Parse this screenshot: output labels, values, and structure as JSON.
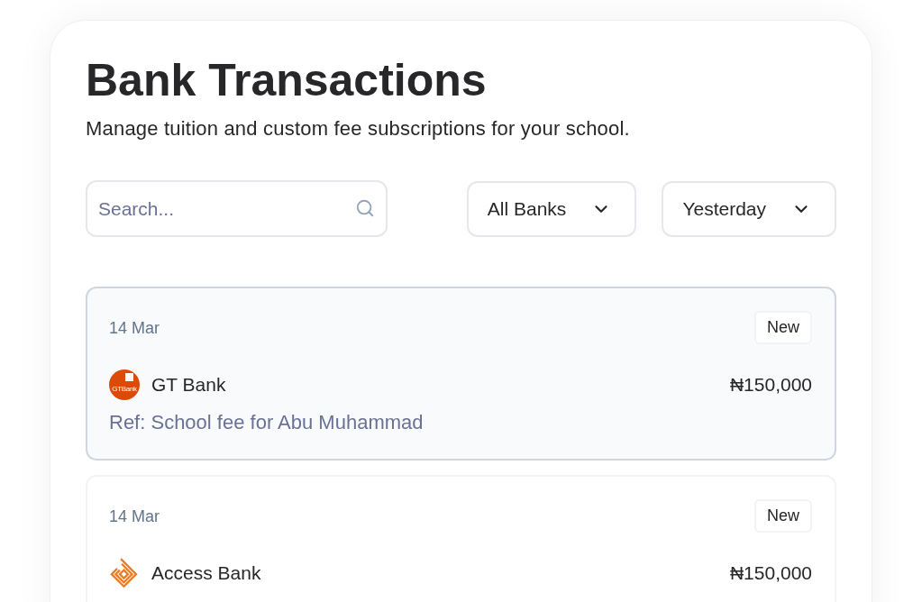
{
  "header": {
    "title": "Bank Transactions",
    "subtitle": "Manage tuition and custom fee subscriptions for your school."
  },
  "filters": {
    "search": {
      "placeholder": "Search..."
    },
    "dropdowns": [
      {
        "value": "All Banks"
      },
      {
        "value": "Yesterday"
      }
    ]
  },
  "transactions": [
    {
      "date": "14 Mar",
      "badge": "New",
      "bank": {
        "kind": "gtbank",
        "name": "GT Bank",
        "logo_text": "GTBank"
      },
      "amount": "₦150,000",
      "ref": "Ref: School fee for Abu Muhammad",
      "selected": true
    },
    {
      "date": "14 Mar",
      "badge": "New",
      "bank": {
        "kind": "access",
        "name": "Access Bank"
      },
      "amount": "₦150,000",
      "selected": false
    }
  ]
}
